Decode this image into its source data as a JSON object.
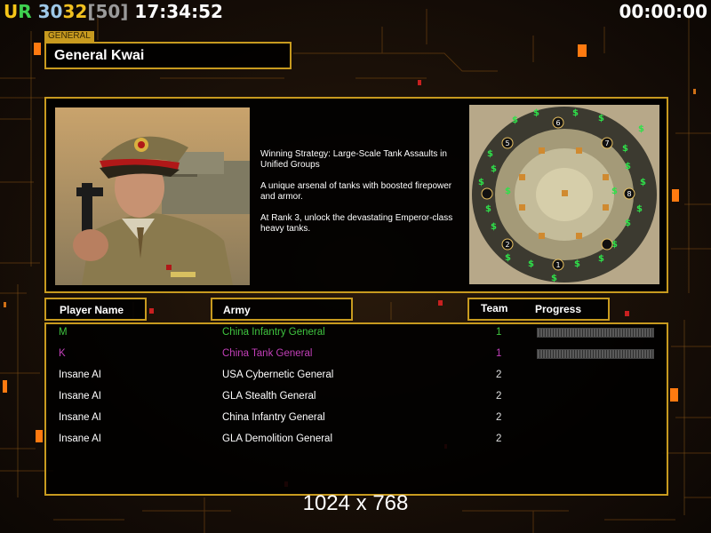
{
  "hud": {
    "ur_label": "UR",
    "fps_a": "30",
    "fps_b": "32",
    "fps_cap": "[50]",
    "clock": "17:34:52",
    "timer": "00:00:00"
  },
  "general": {
    "section_tag": "GENERAL",
    "name": "General Kwai",
    "description": [
      "Winning Strategy: Large-Scale Tank Assaults in Unified Groups",
      "A unique arsenal of tanks with boosted firepower and armor.",
      "At Rank 3, unlock the devastating Emperor-class heavy tanks."
    ]
  },
  "table": {
    "headers": {
      "player": "Player Name",
      "army": "Army",
      "team": "Team",
      "progress": "Progress"
    },
    "rows": [
      {
        "player": "M",
        "army": "China Infantry General",
        "team": "1",
        "color": "#3fc43f",
        "progress": 0
      },
      {
        "player": "K",
        "army": "China Tank General",
        "team": "1",
        "color": "#c23fb8",
        "progress": 0
      },
      {
        "player": "Insane AI",
        "army": "USA Cybernetic General",
        "team": "2",
        "color": "#ffffff"
      },
      {
        "player": "Insane AI",
        "army": "GLA Stealth General",
        "team": "2",
        "color": "#ffffff"
      },
      {
        "player": "Insane AI",
        "army": "China Infantry General",
        "team": "2",
        "color": "#ffffff"
      },
      {
        "player": "Insane AI",
        "army": "GLA Demolition General",
        "team": "2",
        "color": "#ffffff"
      }
    ]
  },
  "map": {
    "start_positions": [
      "1",
      "2",
      "5",
      "6",
      "7",
      "8"
    ]
  },
  "footer": {
    "resolution": "1024 x 768"
  },
  "colors": {
    "accent_gold": "#c79a1f",
    "hud_u": "#f5c518",
    "hud_r": "#3fd14f",
    "hud_30": "#d7c23a",
    "hud_32": "#f0c020",
    "hud_cap": "#9a9a9a",
    "money": "#2fe04a"
  }
}
